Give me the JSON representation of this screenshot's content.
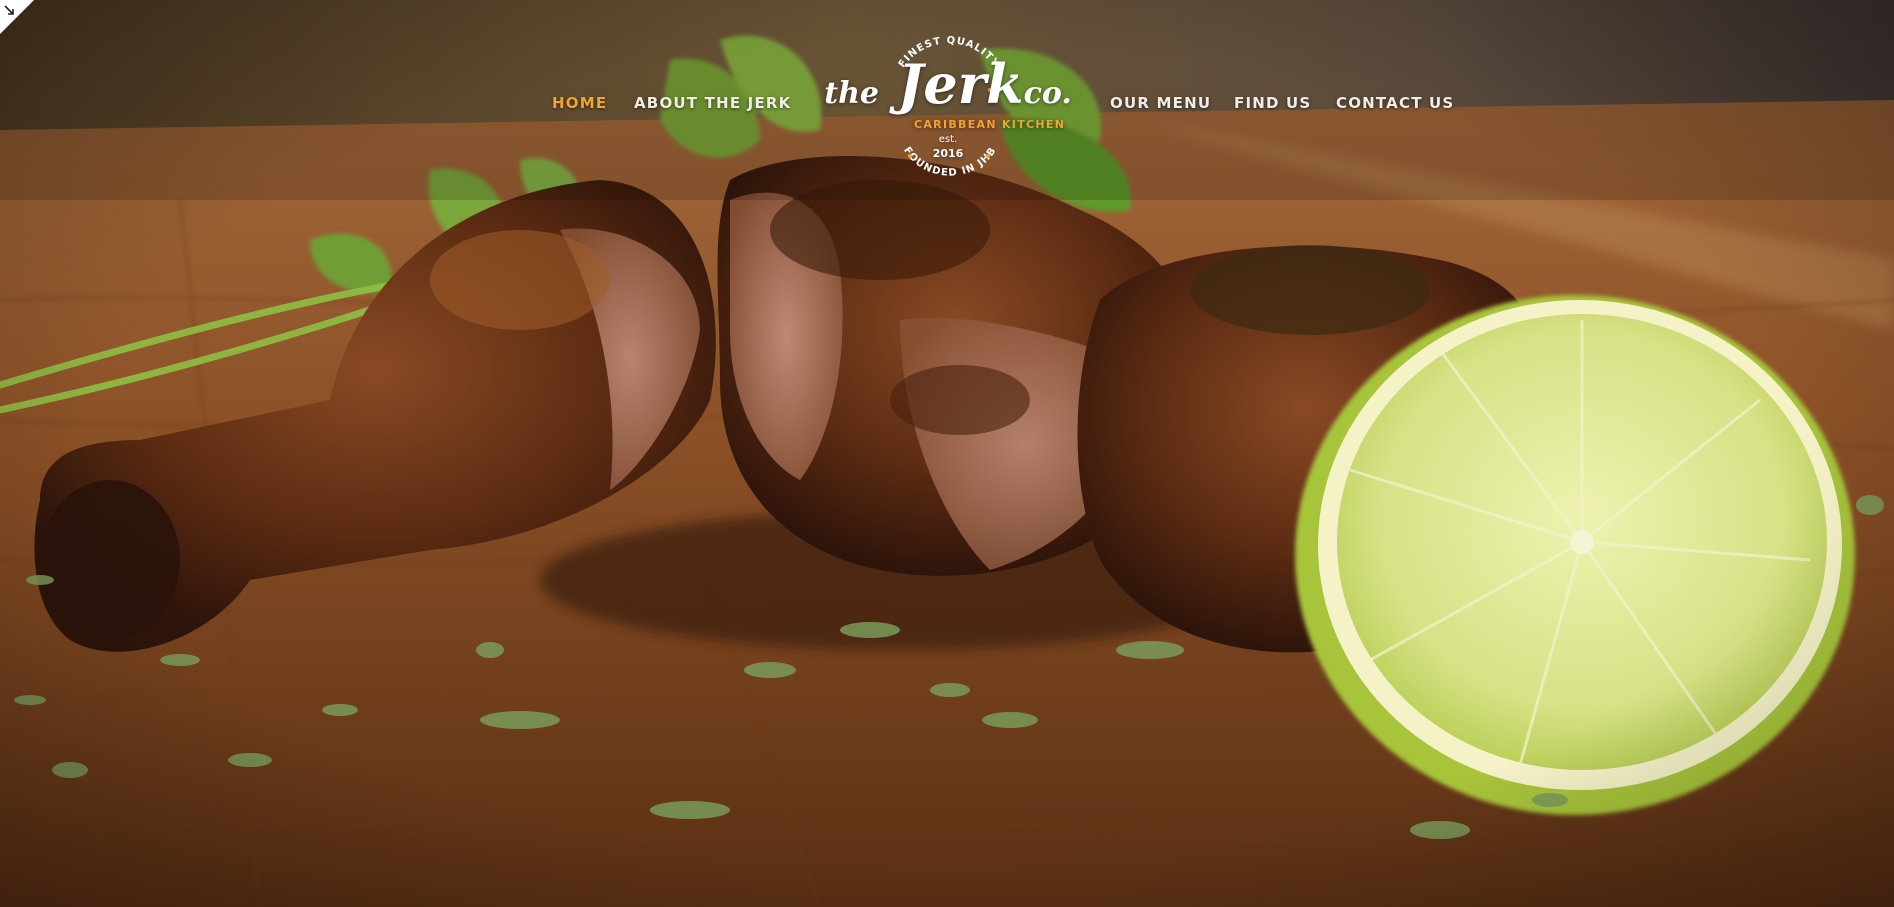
{
  "brand": {
    "logo_top_arc": "FINEST QUALITY",
    "logo_the": "the",
    "logo_name": "Jerk",
    "logo_co": "co.",
    "logo_sub": "CARIBBEAN KITCHEN",
    "logo_est": "est.",
    "logo_year": "2016",
    "logo_bottom_arc": "FOUNDED IN JHB"
  },
  "nav": {
    "items": [
      {
        "label": "HOME",
        "active": true
      },
      {
        "label": "ABOUT THE JERK",
        "active": false
      },
      {
        "label": "OUR MENU",
        "active": false
      },
      {
        "label": "FIND US",
        "active": false
      },
      {
        "label": "CONTACT US",
        "active": false
      }
    ]
  },
  "colors": {
    "accent": "#f0a431",
    "nav_text": "#f1ece6",
    "wood": "#8a4e23",
    "lime": "#d8e38a"
  },
  "icons": {
    "corner": "expand-arrow-icon"
  },
  "hero": {
    "image": "jerk-chicken-photo"
  }
}
